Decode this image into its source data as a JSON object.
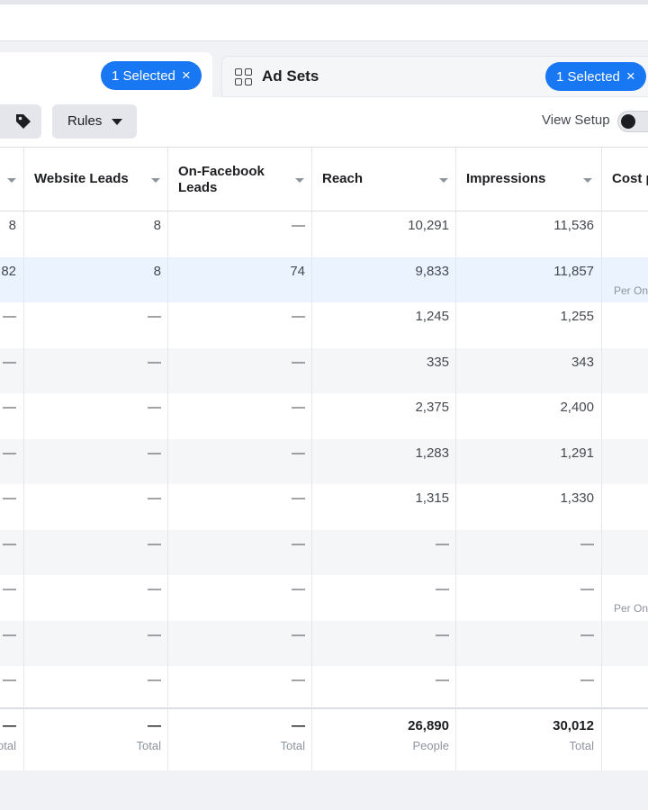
{
  "tabs": {
    "campaigns_selected": "1 Selected",
    "ad_sets_title": "Ad Sets",
    "ad_sets_selected": "1 Selected",
    "close_glyph": "×"
  },
  "toolbar": {
    "rules_label": "Rules",
    "view_setup_label": "View Setup"
  },
  "columns": {
    "c0": "",
    "website_leads": "Website Leads",
    "on_facebook_leads_1": "On-Facebook",
    "on_facebook_leads_2": "Leads",
    "reach": "Reach",
    "impressions": "Impressions",
    "cost": "Cost p"
  },
  "rows": [
    {
      "c0": "8",
      "website_leads": "8",
      "on_facebook": "—",
      "reach": "10,291",
      "impressions": "11,536",
      "cost_sub": ""
    },
    {
      "c0": "82",
      "website_leads": "8",
      "on_facebook": "74",
      "reach": "9,833",
      "impressions": "11,857",
      "cost_sub": "Per On"
    },
    {
      "c0": "—",
      "website_leads": "—",
      "on_facebook": "—",
      "reach": "1,245",
      "impressions": "1,255",
      "cost_sub": ""
    },
    {
      "c0": "—",
      "website_leads": "—",
      "on_facebook": "—",
      "reach": "335",
      "impressions": "343",
      "cost_sub": ""
    },
    {
      "c0": "—",
      "website_leads": "—",
      "on_facebook": "—",
      "reach": "2,375",
      "impressions": "2,400",
      "cost_sub": ""
    },
    {
      "c0": "—",
      "website_leads": "—",
      "on_facebook": "—",
      "reach": "1,283",
      "impressions": "1,291",
      "cost_sub": ""
    },
    {
      "c0": "—",
      "website_leads": "—",
      "on_facebook": "—",
      "reach": "1,315",
      "impressions": "1,330",
      "cost_sub": ""
    },
    {
      "c0": "—",
      "website_leads": "—",
      "on_facebook": "—",
      "reach": "—",
      "impressions": "—",
      "cost_sub": ""
    },
    {
      "c0": "—",
      "website_leads": "—",
      "on_facebook": "—",
      "reach": "—",
      "impressions": "—",
      "cost_sub": "Per On"
    },
    {
      "c0": "—",
      "website_leads": "—",
      "on_facebook": "—",
      "reach": "—",
      "impressions": "—",
      "cost_sub": ""
    },
    {
      "c0": "—",
      "website_leads": "—",
      "on_facebook": "—",
      "reach": "—",
      "impressions": "—",
      "cost_sub": ""
    }
  ],
  "totals": {
    "c0_value": "—",
    "c0_label": "otal",
    "website_leads_value": "—",
    "website_leads_label": "Total",
    "on_facebook_value": "—",
    "on_facebook_label": "Total",
    "reach_value": "26,890",
    "reach_label": "People",
    "impressions_value": "30,012",
    "impressions_label": "Total"
  },
  "colors": {
    "accent": "#1877f2",
    "selected_row": "#ebf3fe"
  }
}
